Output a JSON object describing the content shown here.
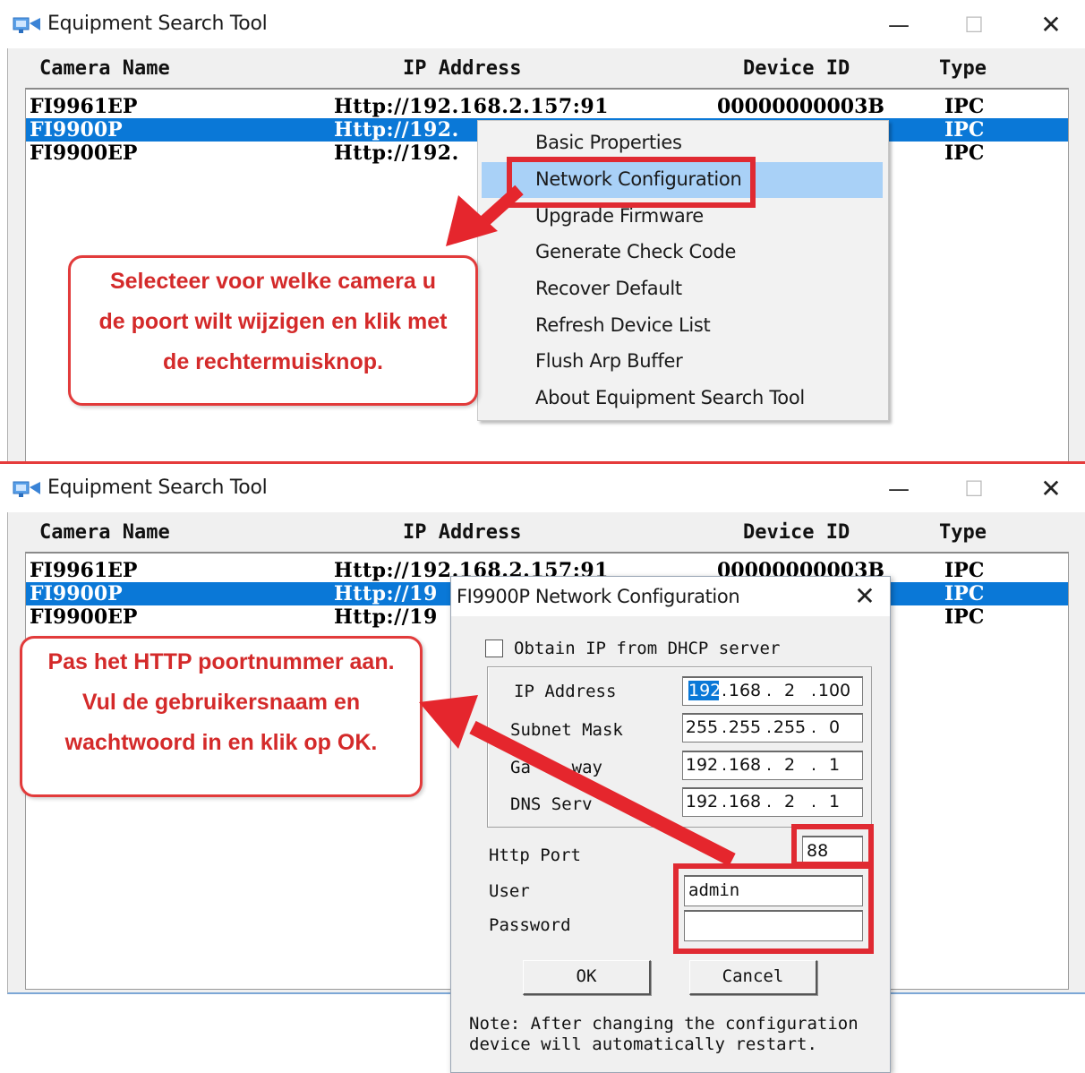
{
  "window": {
    "title": "Equipment Search Tool",
    "minimize": "—",
    "maximize": "☐",
    "close": "✕"
  },
  "columns": {
    "camera_name": "Camera Name",
    "ip_address": "IP Address",
    "device_id": "Device ID",
    "type": "Type"
  },
  "top_list": [
    {
      "name": "FI9961EP",
      "ip": "Http://192.168.2.157:91",
      "device_id": "00000000003B",
      "type": "IPC"
    },
    {
      "name": "FI9900P",
      "ip": "Http://192.",
      "device_id": "",
      "type": "IPC"
    },
    {
      "name": "FI9900EP",
      "ip": "Http://192.",
      "device_id": "",
      "type": "IPC"
    }
  ],
  "bottom_list": [
    {
      "name": "FI9961EP",
      "ip": "Http://192.168.2.157:91",
      "device_id": "00000000003B",
      "type": "IPC"
    },
    {
      "name": "FI9900P",
      "ip": "Http://19",
      "device_id": "",
      "type": "IPC"
    },
    {
      "name": "FI9900EP",
      "ip": "Http://19",
      "device_id": "",
      "type": "IPC"
    }
  ],
  "context_menu": {
    "items": [
      "Basic Properties",
      "Network Configuration",
      "Upgrade Firmware",
      "Generate Check Code",
      "Recover Default",
      "Refresh Device List",
      "Flush Arp Buffer",
      "About Equipment Search Tool"
    ],
    "highlighted_index": 1
  },
  "callout_top": {
    "lines": [
      "Selecteer voor welke camera u",
      "de poort wilt wijzigen en klik met",
      "de rechtermuisknop."
    ]
  },
  "callout_bottom": {
    "lines": [
      "Pas het HTTP poortnummer aan.",
      "Vul de gebruikersnaam en",
      "wachtwoord in en klik op OK."
    ]
  },
  "dialog": {
    "title": "FI9900P Network Configuration",
    "close": "✕",
    "dhcp_label": "Obtain IP from DHCP server",
    "dhcp_checked": false,
    "ip_label": "IP Address",
    "subnet_label": "Subnet Mask",
    "gateway_label_visible": "Ga    way",
    "dns_label_visible": "DNS Serv",
    "ip_address": [
      "192",
      "168",
      "2",
      "100"
    ],
    "subnet_mask": [
      "255",
      "255",
      "255",
      "0"
    ],
    "gateway": [
      "192",
      "168",
      "2",
      "1"
    ],
    "dns_server": [
      "192",
      "168",
      "2",
      "1"
    ],
    "http_port_label": "Http Port",
    "http_port": "88",
    "user_label": "User",
    "user": "admin",
    "password_label": "Password",
    "password": "",
    "ok": "OK",
    "cancel": "Cancel",
    "note_line1": "Note: After changing the configuration",
    "note_line2": "device will automatically restart."
  },
  "colors": {
    "selection": "#0a78d7",
    "menu_highlight": "#a9d1f7",
    "annotation_red": "#e02a32"
  }
}
